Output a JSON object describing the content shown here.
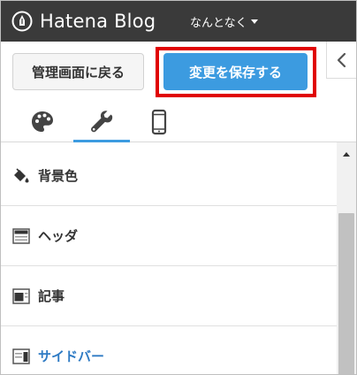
{
  "header": {
    "app_name": "Hatena Blog",
    "blog_selector": "なんとなく",
    "icons": {
      "logo": "hatena-pen-icon",
      "caret": "caret-down-icon"
    }
  },
  "actions": {
    "back_label": "管理画面に戻る",
    "save_label": "変更を保存する",
    "collapse_icon": "chevron-left-icon"
  },
  "tabs": [
    {
      "name": "design",
      "icon": "palette-icon",
      "active": false
    },
    {
      "name": "customize",
      "icon": "wrench-icon",
      "active": true
    },
    {
      "name": "smartphone",
      "icon": "smartphone-icon",
      "active": false
    }
  ],
  "sections": [
    {
      "label": "背景色",
      "icon": "paint-bucket-icon",
      "active": false
    },
    {
      "label": "ヘッダ",
      "icon": "header-layout-icon",
      "active": false
    },
    {
      "label": "記事",
      "icon": "article-layout-icon",
      "active": false
    },
    {
      "label": "サイドバー",
      "icon": "sidebar-layout-icon",
      "active": true
    }
  ],
  "colors": {
    "topbar": "#3a3a3a",
    "accent": "#3c9be0",
    "highlight_border": "#e00000",
    "active_text": "#2f7bc4"
  }
}
